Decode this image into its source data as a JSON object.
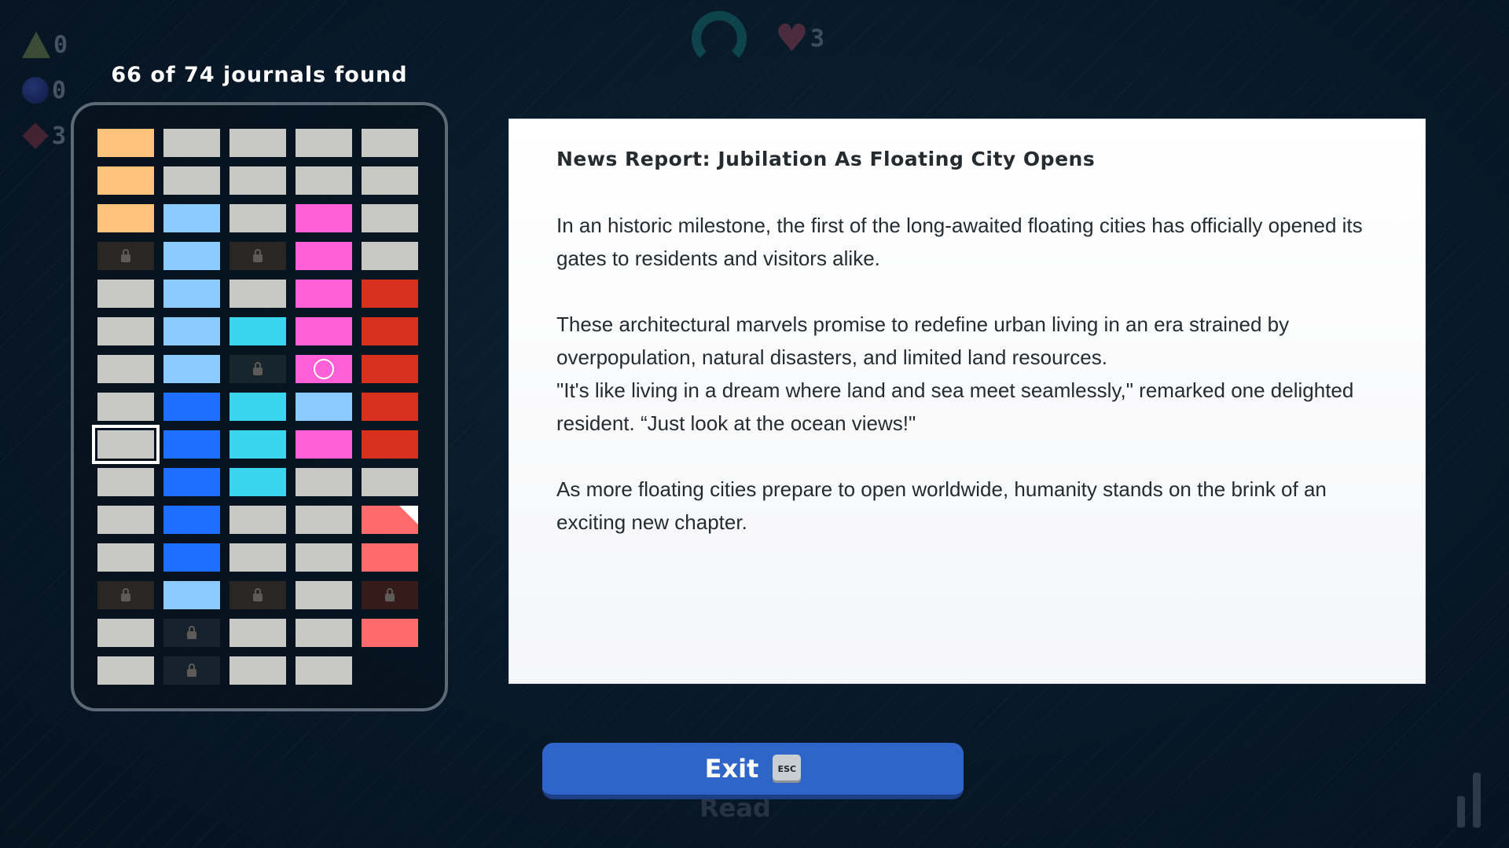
{
  "hud": {
    "items": [
      {
        "icon": "triangle-icon",
        "count": "0"
      },
      {
        "icon": "orb-icon",
        "count": "0"
      },
      {
        "icon": "gem-icon",
        "count": "3"
      }
    ],
    "hearts": "3"
  },
  "journals": {
    "title": "66 of 74 journals found",
    "colors": {
      "orange": "#ffc27a",
      "gray": "#c8c8c6",
      "lightblue": "#8ccbff",
      "pink": "#ff5fd7",
      "red": "#d8301e",
      "cyan": "#3ad4ef",
      "blue": "#1e6eff",
      "salmon": "#ff6a6a"
    },
    "grid": [
      [
        "orange",
        "gray",
        "gray",
        "gray",
        "gray"
      ],
      [
        "orange",
        "gray",
        "gray",
        "gray",
        "gray"
      ],
      [
        "orange",
        "lightblue",
        "gray",
        "pink",
        "gray"
      ],
      [
        "locked",
        "lightblue",
        "locked",
        "pink",
        "gray"
      ],
      [
        "gray",
        "lightblue",
        "gray",
        "pink",
        "red"
      ],
      [
        "gray",
        "lightblue",
        "cyan",
        "pink",
        "red"
      ],
      [
        "gray",
        "lightblue",
        "locked-teal",
        "pink-cursor",
        "red"
      ],
      [
        "gray",
        "blue",
        "cyan",
        "lightblue",
        "red"
      ],
      [
        "gray-selected",
        "blue",
        "cyan",
        "pink",
        "red"
      ],
      [
        "gray",
        "blue",
        "cyan",
        "gray",
        "gray"
      ],
      [
        "gray",
        "blue",
        "gray",
        "gray",
        "salmon-new"
      ],
      [
        "gray",
        "blue",
        "gray",
        "gray",
        "salmon"
      ],
      [
        "locked",
        "lightblue",
        "locked",
        "gray",
        "locked-red"
      ],
      [
        "gray",
        "locked-navy",
        "gray",
        "gray",
        "salmon"
      ],
      [
        "gray",
        "locked-navy",
        "gray",
        "gray",
        "empty"
      ]
    ]
  },
  "page": {
    "title": "News Report: Jubilation As Floating City Opens",
    "paragraph1": "In an historic milestone, the first of the long-awaited floating cities has officially opened its gates to residents and visitors alike.",
    "paragraph2a": "These architectural marvels promise to redefine urban living in an era strained by overpopulation, natural disasters, and limited land resources.",
    "paragraph2b": "\"It's like living in a dream where land and sea meet seamlessly,\" remarked one delighted resident. “Just look at the ocean views!\"",
    "paragraph3": "As more floating cities prepare to open worldwide, humanity stands on the brink of an exciting new chapter."
  },
  "exit": {
    "label": "Exit",
    "key": "ESC",
    "ghost": "Read"
  }
}
